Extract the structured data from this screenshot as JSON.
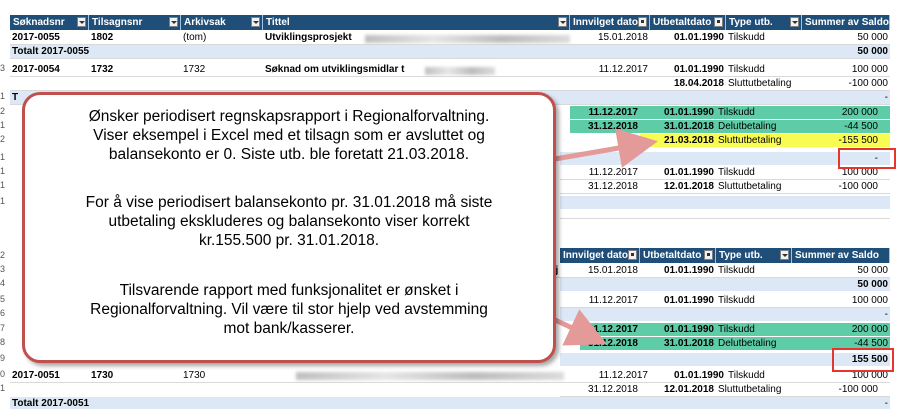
{
  "colors": {
    "header": "#1f4e79",
    "total_row": "#dde8f6",
    "highlight_green": "#5fcca8",
    "highlight_yellow": "#f8fb52",
    "callout_border": "#c0504d",
    "marker": "#e4352f"
  },
  "headers": [
    "Søknadsnr",
    "Tilsagnsnr",
    "Arkivsak",
    "Tittel",
    "Innvilget dato",
    "Utbetaltdato",
    "Type utb.",
    "Summer av Saldo"
  ],
  "top_rows": [
    {
      "soknad": "2017-0055",
      "tilsagn": "1802",
      "arkiv": "(tom)",
      "tittel": "Utviklingsprosjekt",
      "innvilget": "15.01.2018",
      "utbetalt": "01.01.1990",
      "type": "Tilskudd",
      "saldo": "50 000"
    },
    {
      "total": "Totalt 2017-0055",
      "saldo": "50 000"
    },
    {
      "soknad": "2017-0054",
      "tilsagn": "1732",
      "arkiv": "1732",
      "tittel": "Søknad om utviklingsmidlar t",
      "innvilget": "11.12.2017",
      "utbetalt": "01.01.1990",
      "type": "Tilskudd",
      "saldo": "100 000"
    },
    {
      "innvilget": "",
      "utbetalt": "18.04.2018",
      "type": "Sluttutbetaling",
      "saldo": "-100 000"
    },
    {
      "total": "T",
      "saldo": "-"
    },
    {
      "innvilget": "11.12.2017",
      "utbetalt": "01.01.1990",
      "type": "Tilskudd",
      "saldo": "200 000"
    },
    {
      "innvilget": "31.12.2018",
      "utbetalt": "31.01.2018",
      "type": "Delutbetaling",
      "saldo": "-44 500"
    },
    {
      "innvilget": "",
      "utbetalt": "21.03.2018",
      "type": "Sluttutbetaling",
      "saldo": "-155 500"
    },
    {
      "saldo": "-"
    },
    {
      "innvilget": "11.12.2017",
      "utbetalt": "01.01.1990",
      "type": "Tilskudd",
      "saldo": "100 000"
    },
    {
      "innvilget": "31.12.2018",
      "utbetalt": "12.01.2018",
      "type": "Sluttutbetaling",
      "saldo": "-100 000"
    }
  ],
  "bottom_rows": [
    {
      "tittel": "sj",
      "innvilget": "15.01.2018",
      "utbetalt": "01.01.1990",
      "type": "Tilskudd",
      "saldo": "50 000"
    },
    {
      "saldo": "50 000"
    },
    {
      "innvilget": "11.12.2017",
      "utbetalt": "01.01.1990",
      "type": "Tilskudd",
      "saldo": "100 000"
    },
    {
      "saldo": "-"
    },
    {
      "innvilget": "11.12.2017",
      "utbetalt": "01.01.1990",
      "type": "Tilskudd",
      "saldo": "200 000"
    },
    {
      "innvilget": "31.12.2018",
      "utbetalt": "31.01.2018",
      "type": "Delutbetaling",
      "saldo": "-44 500"
    },
    {
      "saldo": "155 500"
    },
    {
      "soknad": "2017-0051",
      "tilsagn": "1730",
      "arkiv": "1730",
      "tittel": "",
      "innvilget": "11.12.2017",
      "utbetalt": "01.01.1990",
      "type": "Tilskudd",
      "saldo": "100 000"
    },
    {
      "innvilget": "31.12.2018",
      "utbetalt": "12.01.2018",
      "type": "Sluttutbetaling",
      "saldo": "-100 000"
    },
    {
      "total": "Totalt 2017-0051",
      "saldo": "-"
    }
  ],
  "row_numbers": [
    "3",
    "1",
    "2",
    "1",
    "2",
    "1",
    "1",
    "1",
    "1",
    "2",
    "3",
    "4",
    "5",
    "6",
    "7",
    "8",
    "9",
    "0",
    "1"
  ],
  "callout": {
    "p1": [
      "Ønsker periodisert regnskapsrapport i Regionalforvaltning.",
      "Viser eksempel i Excel med et tilsagn som er avsluttet og",
      "balansekonto er 0. Siste utb. ble foretatt 21.03.2018."
    ],
    "p2": [
      "For å vise periodisert balansekonto pr. 31.01.2018 må siste",
      "utbetaling ekskluderes og balansekonto viser korrekt",
      "kr.155.500 pr. 31.01.2018."
    ],
    "p3": [
      "Tilsvarende rapport med funksjonalitet er ønsket i",
      "Regionalforvaltning. Vil være til stor hjelp ved avstemming",
      "mot bank/kasserer."
    ]
  }
}
